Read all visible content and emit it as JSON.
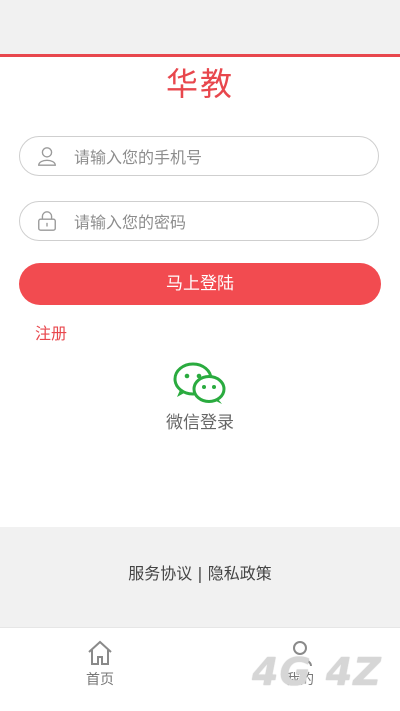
{
  "app": {
    "title": "华教"
  },
  "form": {
    "phone_placeholder": "请输入您的手机号",
    "password_placeholder": "请输入您的密码",
    "login_label": "马上登陆",
    "register_label": "注册"
  },
  "wechat": {
    "label": "微信登录",
    "icon": "wechat-icon"
  },
  "footer": {
    "policy_text": "服务协议 | 隐私政策"
  },
  "tabbar": {
    "items": [
      {
        "label": "首页",
        "icon": "home-icon"
      },
      {
        "label": "我的",
        "icon": "user-icon"
      }
    ]
  },
  "watermark": {
    "text": "4G 4Z"
  },
  "colors": {
    "accent": "#e8474d",
    "button": "#f24b50",
    "wechat": "#2aab3f"
  }
}
